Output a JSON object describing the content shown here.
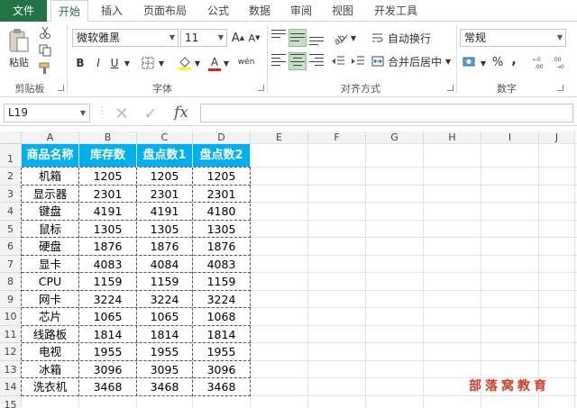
{
  "tabs": [
    {
      "label": "文件"
    },
    {
      "label": "开始"
    },
    {
      "label": "插入"
    },
    {
      "label": "页面布局"
    },
    {
      "label": "公式"
    },
    {
      "label": "数据"
    },
    {
      "label": "审阅"
    },
    {
      "label": "视图"
    },
    {
      "label": "开发工具"
    }
  ],
  "clipboard": {
    "paste_label": "粘贴",
    "group_label": "剪贴板"
  },
  "font": {
    "name": "微软雅黑",
    "size": "11",
    "group_label": "字体",
    "bold": "B",
    "italic": "I",
    "underline": "U",
    "grow": "A",
    "shrink": "A",
    "font_color": "A",
    "phonetic": "wén"
  },
  "alignment": {
    "wrap_label": "自动换行",
    "merge_label": "合并后居中",
    "group_label": "对齐方式"
  },
  "number": {
    "format": "常规",
    "group_label": "数字",
    "percent": "%",
    "comma": ","
  },
  "formula_bar": {
    "name_box": "L19",
    "fx": "fx",
    "value": ""
  },
  "columns": [
    "A",
    "B",
    "C",
    "D",
    "E",
    "F",
    "G",
    "H",
    "I",
    "J"
  ],
  "table": {
    "headers": [
      "商品名称",
      "库存数",
      "盘点数1",
      "盘点数2"
    ],
    "rows": [
      [
        "机箱",
        "1205",
        "1205",
        "1205"
      ],
      [
        "显示器",
        "2301",
        "2301",
        "2301"
      ],
      [
        "键盘",
        "4191",
        "4191",
        "4180"
      ],
      [
        "鼠标",
        "1305",
        "1305",
        "1305"
      ],
      [
        "硬盘",
        "1876",
        "1876",
        "1876"
      ],
      [
        "显卡",
        "4083",
        "4084",
        "4083"
      ],
      [
        "CPU",
        "1159",
        "1159",
        "1159"
      ],
      [
        "网卡",
        "3224",
        "3224",
        "3224"
      ],
      [
        "芯片",
        "1065",
        "1065",
        "1068"
      ],
      [
        "线路板",
        "1814",
        "1814",
        "1814"
      ],
      [
        "电视",
        "1955",
        "1955",
        "1955"
      ],
      [
        "冰箱",
        "3096",
        "3095",
        "3096"
      ],
      [
        "洗衣机",
        "3468",
        "3468",
        "3468"
      ]
    ]
  },
  "watermark": "部落窝教育",
  "colors": {
    "accent": "#217346",
    "header_fill": "#00b0f0",
    "watermark": "#d63a22"
  }
}
